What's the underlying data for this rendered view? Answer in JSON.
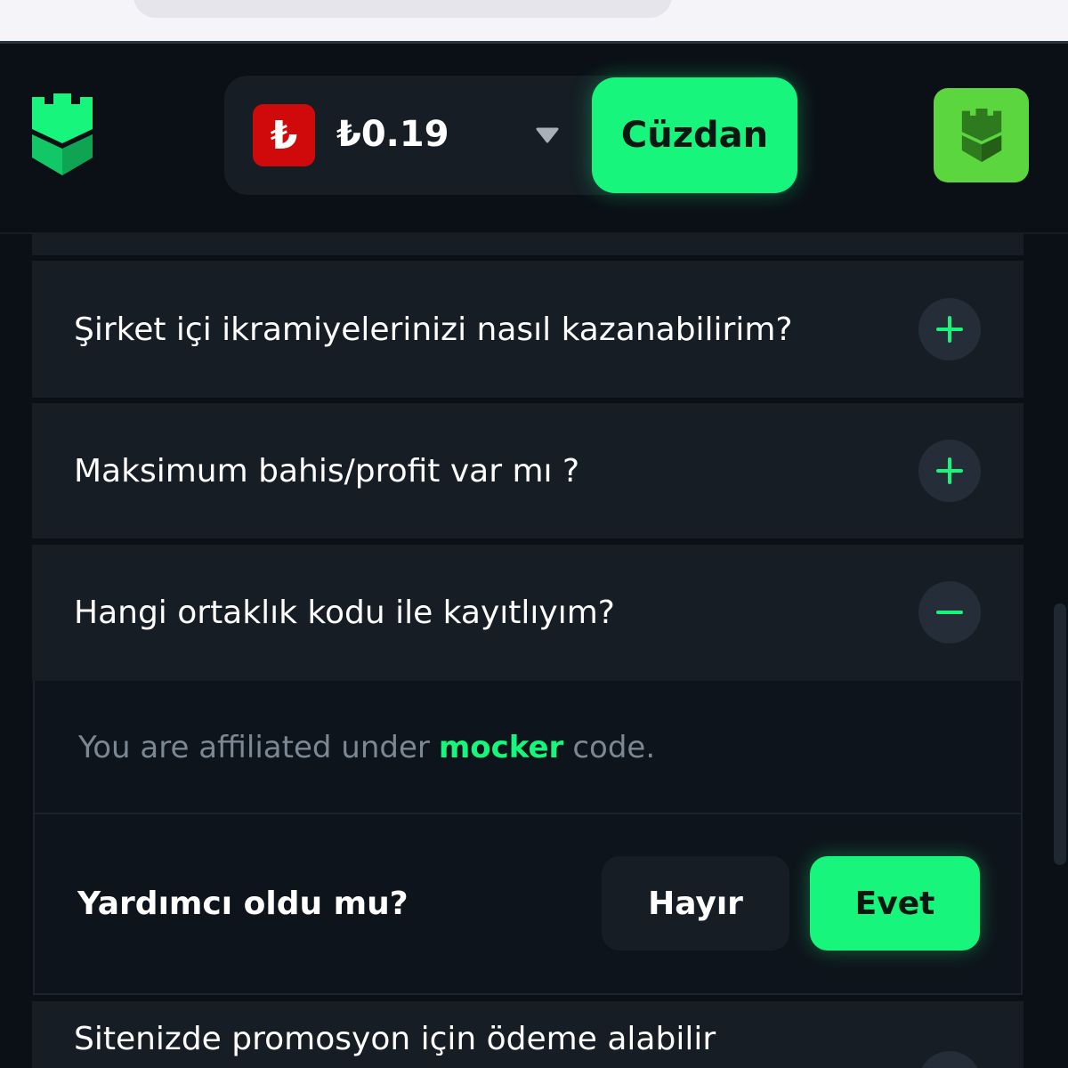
{
  "header": {
    "currency_symbol": "₺",
    "balance": "₺0.19",
    "wallet_label": "Cüzdan"
  },
  "faq": {
    "items": [
      {
        "question": "Şirket içi ikramiyelerinizi nasıl kazanabilirim?",
        "expanded": false
      },
      {
        "question": "Maksimum bahis/profit var mı ?",
        "expanded": false
      },
      {
        "question": "Hangi ortaklık kodu ile kayıtlıyım?",
        "expanded": true
      },
      {
        "question": "Sitenizde promosyon için ödeme alabilir",
        "expanded": false
      }
    ],
    "answer": {
      "prefix": "You are affiliated under",
      "code": "mocker",
      "suffix": "code."
    },
    "feedback": {
      "question": "Yardımcı oldu mu?",
      "no_label": "Hayır",
      "yes_label": "Evet"
    }
  },
  "colors": {
    "accent": "#17f57d",
    "background": "#0b1016",
    "card": "#161d25",
    "currency_badge": "#d00a0a",
    "avatar": "#5bd63e"
  }
}
